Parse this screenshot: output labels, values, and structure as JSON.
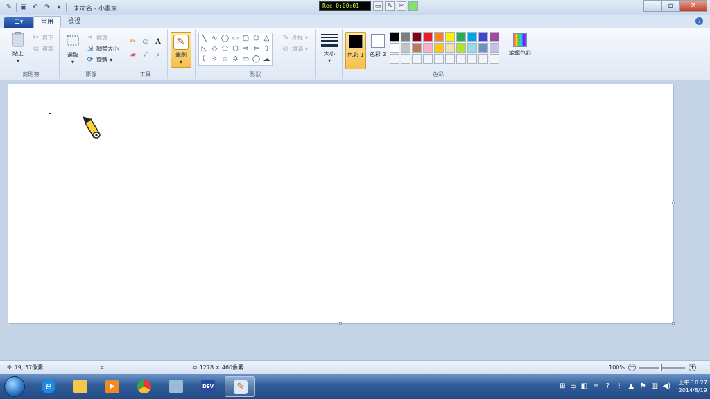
{
  "window": {
    "title": "未命名 - 小畫家",
    "rec_time": "Rec 0:00:01"
  },
  "tabs": [
    {
      "label": "常用",
      "active": true
    },
    {
      "label": "檢視",
      "active": false
    }
  ],
  "ribbon": {
    "clipboard": {
      "label": "剪貼簿",
      "paste": "貼上",
      "cut": "剪下",
      "copy": "複製"
    },
    "image": {
      "label": "影像",
      "select": "選取",
      "crop": "裁剪",
      "resize": "調整大小",
      "rotate": "旋轉"
    },
    "tools": {
      "label": "工具"
    },
    "brushes": {
      "label": "筆刷"
    },
    "shapes": {
      "label": "形狀",
      "outline": "外框",
      "fill": "填滿"
    },
    "size": {
      "label": "大小"
    },
    "colors": {
      "label": "色彩",
      "color1": "色彩 1",
      "color2": "色彩 2",
      "edit": "編輯色彩",
      "color1_value": "#000000",
      "color2_value": "#ffffff",
      "palette": [
        "#000000",
        "#7f7f7f",
        "#880015",
        "#ed1c24",
        "#ff7f27",
        "#fff200",
        "#22b14c",
        "#00a2e8",
        "#3f48cc",
        "#a349a4",
        "#ffffff",
        "#c3c3c3",
        "#b97a57",
        "#ffaec9",
        "#ffc90e",
        "#efe4b0",
        "#b5e61d",
        "#99d9ea",
        "#7092be",
        "#c8bfe7",
        "#f3f5f8",
        "#f3f5f8",
        "#f3f5f8",
        "#f3f5f8",
        "#f3f5f8",
        "#f3f5f8",
        "#f3f5f8",
        "#f3f5f8",
        "#f3f5f8",
        "#f3f5f8"
      ]
    }
  },
  "status": {
    "cursor_pos": "79, 57像素",
    "canvas_size": "1278 × 460像素",
    "zoom": "100%"
  },
  "taskbar": {
    "apps": [
      {
        "name": "internet-explorer",
        "color": "#1e88e5"
      },
      {
        "name": "file-explorer",
        "color": "#f2c84b"
      },
      {
        "name": "media-player",
        "color": "#f08a24"
      },
      {
        "name": "chrome",
        "color": "#e53935"
      },
      {
        "name": "remote-desktop",
        "color": "#9bbad8"
      },
      {
        "name": "dev-cpp",
        "color": "#2a4b9b"
      },
      {
        "name": "paint",
        "color": "#dce9f7"
      }
    ],
    "ime": "中",
    "time": "上午 10:27",
    "date": "2014/8/19"
  }
}
